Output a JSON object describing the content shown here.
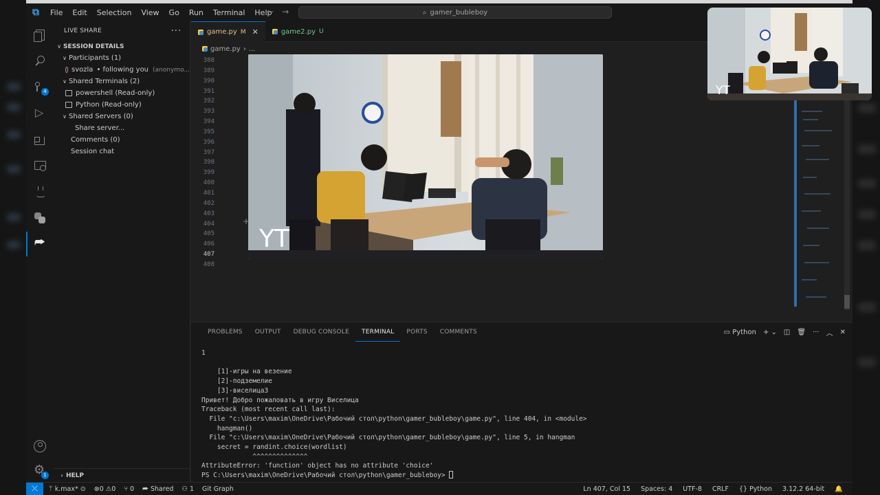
{
  "app": {
    "search_text": "gamer_bubleboy",
    "menu": [
      "File",
      "Edit",
      "Selection",
      "View",
      "Go",
      "Run",
      "Terminal",
      "Help"
    ]
  },
  "activity": {
    "source_control_badge": "4",
    "settings_badge": "1"
  },
  "sidebar": {
    "title": "LIVE SHARE",
    "session_details": "SESSION DETAILS",
    "participants_header": "Participants (1)",
    "participant_name": "svozla",
    "participant_status": "• following you",
    "participant_note": "(anonymo...",
    "terminals_header": "Shared Terminals (2)",
    "terminal_1": "powershell (Read-only)",
    "terminal_2": "Python (Read-only)",
    "servers_header": "Shared Servers (0)",
    "share_server": "Share server...",
    "comments": "Comments (0)",
    "session_chat": "Session chat",
    "help": "HELP"
  },
  "editor": {
    "tabs": [
      {
        "label": "game.py",
        "status": "M"
      },
      {
        "label": "game2.py",
        "status": "U"
      }
    ],
    "breadcrumb_file": "game.py",
    "breadcrumb_more": "...",
    "line_numbers": [
      "388",
      "389",
      "390",
      "391",
      "392",
      "393",
      "394",
      "395",
      "396",
      "397",
      "398",
      "399",
      "400",
      "401",
      "402",
      "403",
      "404",
      "405",
      "406",
      "407",
      "408"
    ],
    "current_line": "407"
  },
  "panel": {
    "tabs": [
      "PROBLEMS",
      "OUTPUT",
      "DEBUG CONSOLE",
      "TERMINAL",
      "PORTS",
      "COMMENTS"
    ],
    "active_tab": "TERMINAL",
    "terminal_name": "Python",
    "terminal_lines": [
      "1",
      "",
      "    [1]-игры на везение",
      "    [2]-подземелие",
      "    [3]-виселица3",
      "Привет! Добро пожаловать в игру Виселица",
      "Traceback (most recent call last):",
      "  File \"c:\\Users\\maxim\\OneDrive\\Рабочий стол\\python\\gamer_bubleboy\\game.py\", line 404, in <module>",
      "    hangman()",
      "  File \"c:\\Users\\maxim\\OneDrive\\Рабочий стол\\python\\gamer_bubleboy\\game.py\", line 5, in hangman",
      "    secret = randint.choice(wordlist)",
      "             ^^^^^^^^^^^^^^",
      "AttributeError: 'function' object has no attribute 'choice'"
    ],
    "prompt": "PS C:\\Users\\maxim\\OneDrive\\Рабочий стол\\python\\gamer_bubleboy> "
  },
  "statusbar": {
    "branch": "k.max*",
    "errors": "0",
    "warnings": "0",
    "ports": "0",
    "shared": "Shared",
    "live_count": "1",
    "git_graph": "Git Graph",
    "position": "Ln 407, Col 15",
    "spaces": "Spaces: 4",
    "encoding": "UTF-8",
    "eol": "CRLF",
    "language": "Python",
    "interpreter": "3.12.2 64-bit"
  },
  "video": {
    "main_label": "YT",
    "pip_label": "YT"
  }
}
